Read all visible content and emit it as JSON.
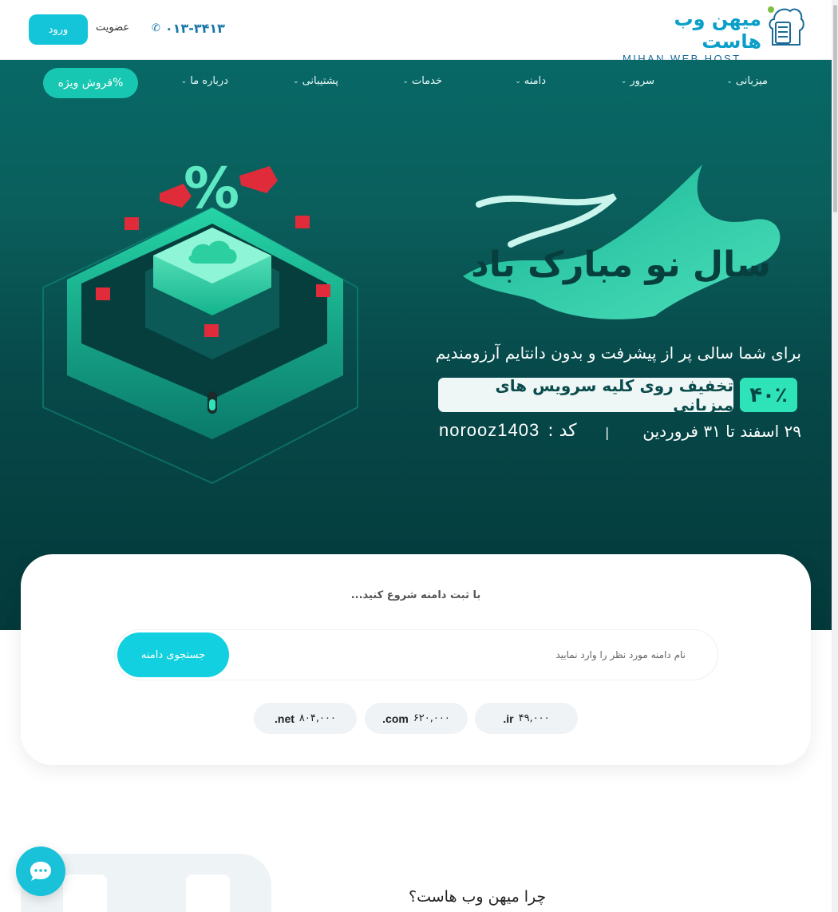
{
  "header": {
    "logo_fa": "میهن وب هاست",
    "logo_en": "MIHAN WEB HOST",
    "phone": "۰۱۳-۳۴۱۳",
    "signup_label": "عضویت",
    "login_label": "ورود"
  },
  "nav": {
    "items": [
      {
        "label": "میزبانی"
      },
      {
        "label": "سرور"
      },
      {
        "label": "دامنه"
      },
      {
        "label": "خدمات"
      },
      {
        "label": "پشتیبانی"
      },
      {
        "label": "درباره ما"
      }
    ],
    "special_label": "فروش ویژه%"
  },
  "hero": {
    "calligraphy": "سال نو مبارک باد",
    "tagline": "برای شما سالی پر از پیشرفت و بدون دانتایم آرزومندیم",
    "discount_percent": "۴۰٪",
    "discount_text": "تخفیف روی کلیه سرویس های میزبانی",
    "date_range": "۲۹ اسفند تا ۳۱ فروردین",
    "separator": "|",
    "code_label": "کد :",
    "code_value": "norooz1403",
    "percent_symbol": "%"
  },
  "domain": {
    "title": "با ثبت دامنه شروع کنید...",
    "search_placeholder": "نام دامنه مورد نظر را وارد نمایید",
    "search_value": "",
    "search_button": "جستجوی دامنه",
    "tlds": [
      {
        "name": ".ir",
        "price": "۴۹,۰۰۰"
      },
      {
        "name": ".com",
        "price": "۶۲۰,۰۰۰"
      },
      {
        "name": ".net",
        "price": "۸۰۴,۰۰۰"
      }
    ]
  },
  "why": {
    "title": "چرا میهن وب هاست؟"
  },
  "colors": {
    "accent": "#14c4d8",
    "hero_top": "#076866",
    "hero_bottom": "#04393a",
    "discount_badge": "#2fe3b9",
    "special_btn": "#17c7b1"
  },
  "icons": {
    "phone": "phone-icon",
    "chevron": "chevron-down-icon",
    "chat": "chat-icon",
    "logo": "cloud-server-icon"
  }
}
